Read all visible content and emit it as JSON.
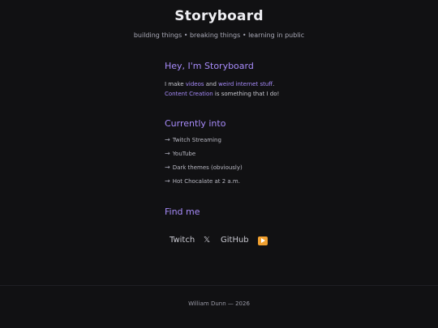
{
  "header": {
    "title": "Storyboard",
    "tagline": "building things • breaking things • learning in public"
  },
  "intro": {
    "heading": "Hey, I'm Storyboard",
    "line1_prefix": "I make ",
    "link_videos": "videos",
    "line1_mid": " and ",
    "link_weird": "weird internet stuff",
    "line1_suffix": ".",
    "link_content": "Content Creation",
    "line2_suffix": " is something that I do!"
  },
  "interests": {
    "heading": "Currently into",
    "arrow": "→",
    "items": [
      "Twitch Streaming",
      "YouTube",
      "Dark themes (obviously)",
      "Hot Chocalate at 2 a.m."
    ]
  },
  "find": {
    "heading": "Find me",
    "twitch": "Twitch",
    "x": "𝕏",
    "github": "GitHub",
    "youtube_icon": "play-button-icon"
  },
  "footer": {
    "text": "William Dunn — 2026"
  },
  "colors": {
    "background": "#111113",
    "accent": "#a78bfa",
    "youtube": "#f0a030"
  }
}
